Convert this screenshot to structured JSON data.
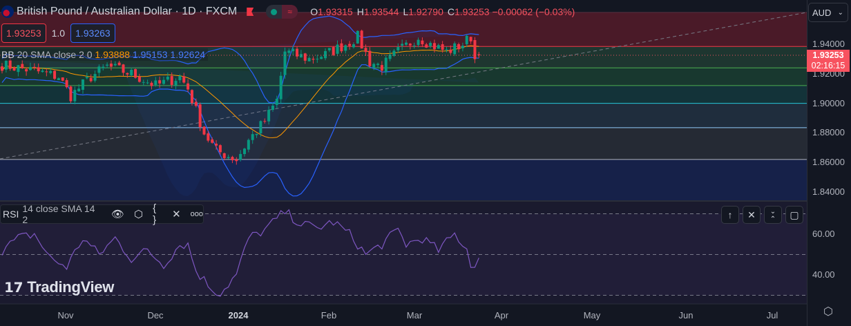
{
  "header": {
    "title": "British Pound / Australian Dollar · 1D · FXCM",
    "ohlc": [
      {
        "k": "O",
        "v": "1.93315"
      },
      {
        "k": "H",
        "v": "1.93544"
      },
      {
        "k": "L",
        "v": "1.92790"
      },
      {
        "k": "C",
        "v": "1.93253 −0.00062 (−0.03%)"
      }
    ],
    "bid": "1.93253",
    "spread": "1.0",
    "ask": "1.93263"
  },
  "bb": {
    "name": "BB",
    "params": "20 SMA close 2 0",
    "basis": "1.93888",
    "upper": "1.95153",
    "lower": "1.92624"
  },
  "axis": {
    "currency": "AUD",
    "last_price": "1.93253",
    "countdown": "02:16:15",
    "price_ticks": [
      "1.94000",
      "1.92000",
      "1.90000",
      "1.88000",
      "1.86000",
      "1.84000"
    ],
    "rsi_ticks": [
      "60.00",
      "40.00"
    ]
  },
  "rsi": {
    "name": "RSI",
    "params": "14 close SMA 14 2"
  },
  "time_axis": [
    "Nov",
    "Dec",
    "2024",
    "Feb",
    "Mar",
    "Apr",
    "May",
    "Jun",
    "Jul"
  ],
  "watermark": "TradingView",
  "colors": {
    "up": "#089981",
    "down": "#f23645",
    "bb_band": "#2962ff",
    "bb_basis": "#ff9800",
    "rsi": "#7e57c2"
  },
  "chart_data": {
    "type": "candlestick",
    "title": "British Pound / Australian Dollar · 1D · FXCM",
    "ylim": [
      1.83,
      1.965
    ],
    "fib_levels": [
      1.962,
      1.9385,
      1.924,
      1.912,
      1.9,
      1.8835,
      1.862
    ],
    "price_keypoints": [
      [
        0,
        1.926
      ],
      [
        8,
        1.922
      ],
      [
        14,
        1.918
      ],
      [
        17,
        1.905
      ],
      [
        22,
        1.918
      ],
      [
        26,
        1.925
      ],
      [
        32,
        1.92
      ],
      [
        38,
        1.912
      ],
      [
        44,
        1.918
      ],
      [
        46,
        1.91
      ],
      [
        50,
        1.88
      ],
      [
        53,
        1.868
      ],
      [
        58,
        1.862
      ],
      [
        61,
        1.875
      ],
      [
        65,
        1.888
      ],
      [
        68,
        1.902
      ],
      [
        70,
        1.935
      ],
      [
        76,
        1.93
      ],
      [
        80,
        1.933
      ],
      [
        85,
        1.94
      ],
      [
        88,
        1.945
      ],
      [
        91,
        1.928
      ],
      [
        94,
        1.925
      ],
      [
        98,
        1.935
      ],
      [
        103,
        1.945
      ],
      [
        106,
        1.94
      ],
      [
        110,
        1.935
      ],
      [
        114,
        1.94
      ],
      [
        116,
        1.945
      ],
      [
        117,
        1.93
      ],
      [
        118,
        1.9325
      ]
    ],
    "rsi_keypoints": [
      [
        0,
        52
      ],
      [
        4,
        58
      ],
      [
        8,
        60
      ],
      [
        12,
        48
      ],
      [
        16,
        44
      ],
      [
        20,
        58
      ],
      [
        24,
        50
      ],
      [
        28,
        58
      ],
      [
        32,
        48
      ],
      [
        36,
        52
      ],
      [
        40,
        45
      ],
      [
        44,
        55
      ],
      [
        46,
        55
      ],
      [
        48,
        42
      ],
      [
        52,
        33
      ],
      [
        54,
        31
      ],
      [
        58,
        40
      ],
      [
        61,
        58
      ],
      [
        65,
        62
      ],
      [
        70,
        71
      ],
      [
        74,
        65
      ],
      [
        78,
        63
      ],
      [
        82,
        66
      ],
      [
        86,
        60
      ],
      [
        90,
        50
      ],
      [
        94,
        55
      ],
      [
        98,
        62
      ],
      [
        100,
        55
      ],
      [
        104,
        58
      ],
      [
        108,
        52
      ],
      [
        112,
        60
      ],
      [
        115,
        53
      ],
      [
        116,
        44
      ],
      [
        118,
        48
      ]
    ],
    "rsi_levels": [
      70,
      50,
      30
    ],
    "rsi_ylim": [
      20,
      80
    ]
  }
}
